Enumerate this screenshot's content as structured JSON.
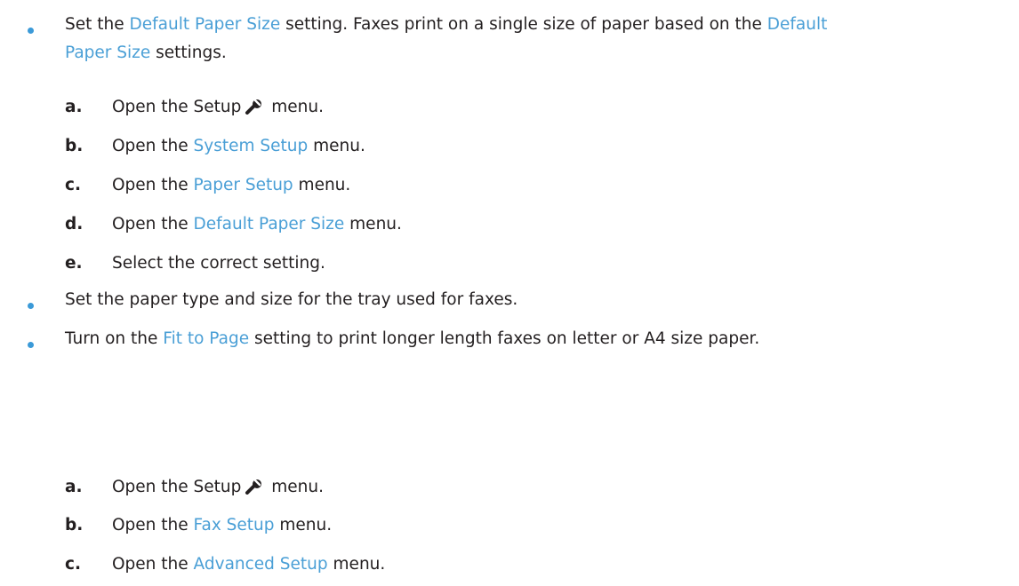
{
  "items": [
    {
      "t1": "Set the ",
      "l1": "Default Paper Size",
      "t2": " setting. Faxes print on a single size of paper based on the ",
      "l2": "Default",
      "l3": "Paper Size",
      "t3": " settings.",
      "steps": [
        {
          "letter": "a.",
          "pre": "Open the Setup",
          "post": " menu.",
          "icon": "wrench-icon"
        },
        {
          "letter": "b.",
          "pre": "Open the ",
          "link": "System Setup",
          "post": " menu."
        },
        {
          "letter": "c.",
          "pre": "Open the ",
          "link": "Paper Setup",
          "post": " menu."
        },
        {
          "letter": "d.",
          "pre": "Open the ",
          "link": "Default Paper Size",
          "post": " menu."
        },
        {
          "letter": "e.",
          "pre": "Select the correct setting."
        }
      ]
    },
    {
      "t1": "Set the paper type and size for the tray used for faxes."
    },
    {
      "t1": "Turn on the ",
      "l1": "Fit to Page",
      "t2": " setting to print longer length faxes on letter or A4 size paper.",
      "steps": [
        {
          "letter": "a.",
          "pre": "Open the Setup",
          "post": " menu.",
          "icon": "wrench-icon"
        },
        {
          "letter": "b.",
          "pre": "Open the ",
          "link": "Fax Setup",
          "post": " menu."
        },
        {
          "letter": "c.",
          "pre": "Open the ",
          "link": "Advanced Setup",
          "post": " menu."
        }
      ]
    }
  ],
  "colors": {
    "highlight": "#4a9fd6",
    "bullet": "#3b9ad8",
    "text": "#231f20"
  }
}
